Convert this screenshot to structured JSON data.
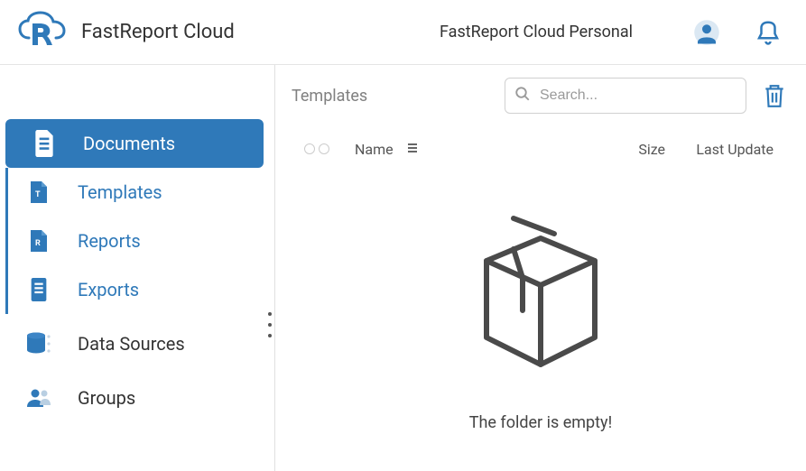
{
  "header": {
    "app_title": "FastReport Cloud",
    "workspace": "FastReport Cloud Personal"
  },
  "sidebar": {
    "items": [
      {
        "label": "Documents"
      },
      {
        "label": "Templates"
      },
      {
        "label": "Reports"
      },
      {
        "label": "Exports"
      },
      {
        "label": "Data Sources"
      },
      {
        "label": "Groups"
      }
    ]
  },
  "toolbar": {
    "breadcrumb": "Templates",
    "search_placeholder": "Search..."
  },
  "columns": {
    "name": "Name",
    "size": "Size",
    "update": "Last Update"
  },
  "empty": {
    "message": "The folder is empty!"
  }
}
